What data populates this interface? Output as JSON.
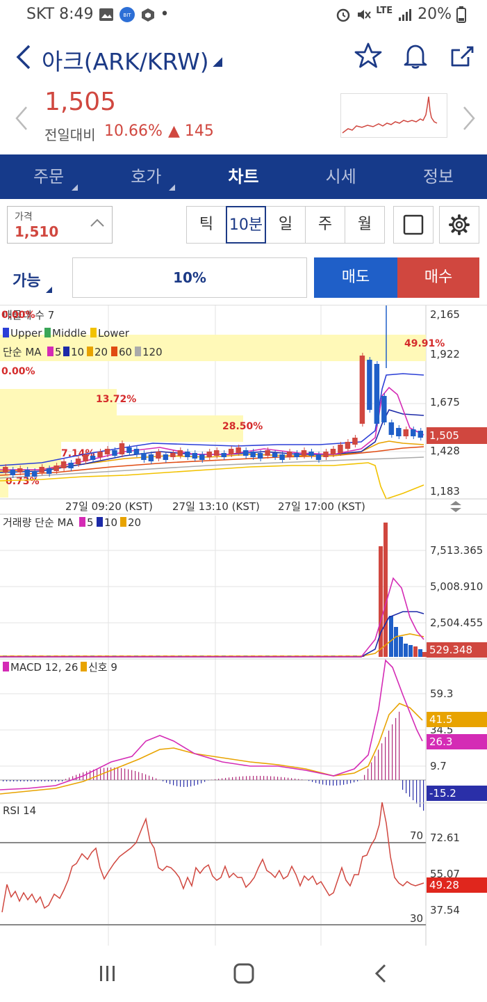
{
  "status_bar": {
    "carrier": "SKT",
    "time": "8:49",
    "network": "LTE",
    "battery": "20%"
  },
  "header": {
    "title": "아크(ARK/KRW)"
  },
  "price_info": {
    "current_price": "1,505",
    "prev_day_label": "전일대비",
    "change_pct": "10.66%",
    "change_amount": "▲ 145"
  },
  "tabs": [
    {
      "label": "주문",
      "has_menu": true
    },
    {
      "label": "호가",
      "has_menu": true
    },
    {
      "label": "차트",
      "active": true
    },
    {
      "label": "시세"
    },
    {
      "label": "정보"
    }
  ],
  "controls": {
    "price_label": "가격",
    "price_value": "1,510",
    "periods": [
      "틱",
      "10분",
      "일",
      "주",
      "월"
    ],
    "active_period": "10분"
  },
  "order": {
    "avail_label": "가능",
    "percent": "10%",
    "sell_label": "매도",
    "buy_label": "매수"
  },
  "colors": {
    "brand_blue": "#163a8a",
    "up_red": "#d0473f",
    "down_blue": "#1f5fc8",
    "fibo_band": "#fff9b8"
  },
  "chart_data": {
    "type": "candlestick-with-indicators",
    "price_panel": {
      "legend_line1": "매물대 수 7",
      "bollinger_legend": [
        "Upper",
        "Middle",
        "Lower"
      ],
      "ma_legend_label": "단순 MA",
      "ma_periods": [
        "5",
        "10",
        "20",
        "60",
        "120"
      ],
      "y_ticks": [
        "2,165",
        "1,922",
        "1,675",
        "1,428",
        "1,183"
      ],
      "last_price_tag": "1,505",
      "fibo_labels": [
        "0.00%",
        "49.91%",
        "0.00%",
        "13.72%",
        "28.50%",
        "7.14%",
        "0.73%"
      ],
      "x_ticks": [
        "27일 09:20 (KST)",
        "27일 13:10 (KST)",
        "27일 17:00 (KST)"
      ]
    },
    "volume_panel": {
      "legend_label": "거래량 단순 MA",
      "ma_periods": [
        "5",
        "10",
        "20"
      ],
      "y_ticks": [
        "7,513.365",
        "5,008.910",
        "2,504.455"
      ],
      "last_tag": "529.348"
    },
    "macd_panel": {
      "legend_macd": "MACD 12, 26",
      "legend_signal": "신호 9",
      "y_ticks": [
        "59.3",
        "34.5",
        "9.7"
      ],
      "tags": [
        "41.5",
        "26.3",
        "-15.2"
      ]
    },
    "rsi_panel": {
      "legend": "RSI 14",
      "y_ticks": [
        "72.61",
        "55.07",
        "37.54"
      ],
      "levels": [
        "70",
        "30"
      ],
      "last_tag": "49.28"
    }
  }
}
